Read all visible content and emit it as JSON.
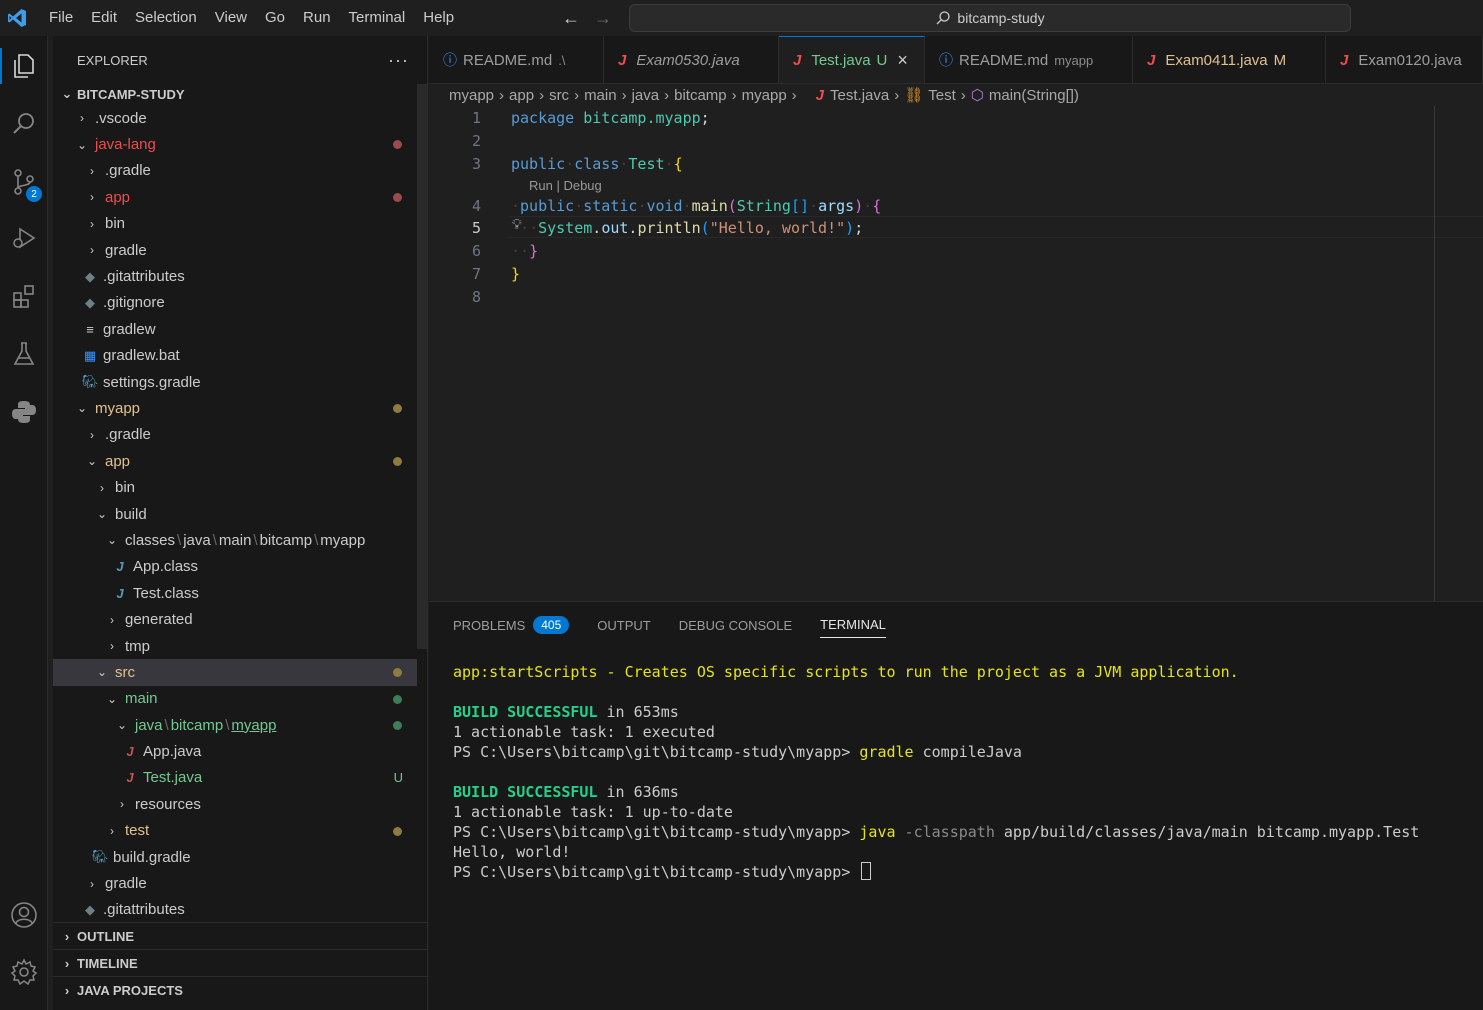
{
  "titlebar": {
    "menu": [
      "File",
      "Edit",
      "Selection",
      "View",
      "Go",
      "Run",
      "Terminal",
      "Help"
    ],
    "search_text": "bitcamp-study"
  },
  "activity": {
    "scm_badge": "2"
  },
  "sidebar": {
    "title": "EXPLORER",
    "more": "···",
    "root": "BITCAMP-STUDY",
    "items": [
      {
        "label": ".vscode"
      },
      {
        "label": "java-lang"
      },
      {
        "label": ".gradle"
      },
      {
        "label": "app"
      },
      {
        "label": "bin"
      },
      {
        "label": "gradle"
      },
      {
        "label": ".gitattributes"
      },
      {
        "label": ".gitignore"
      },
      {
        "label": "gradlew"
      },
      {
        "label": "gradlew.bat"
      },
      {
        "label": "settings.gradle"
      },
      {
        "label": "myapp"
      },
      {
        "label": ".gradle"
      },
      {
        "label": "app"
      },
      {
        "label": "bin"
      },
      {
        "label": "build"
      },
      {
        "label": "classes",
        "parts": [
          "java",
          "main",
          "bitcamp",
          "myapp"
        ]
      },
      {
        "label": "App.class"
      },
      {
        "label": "Test.class"
      },
      {
        "label": "generated"
      },
      {
        "label": "tmp"
      },
      {
        "label": "src"
      },
      {
        "label": "main"
      },
      {
        "label": "java",
        "parts": [
          "bitcamp",
          "myapp"
        ]
      },
      {
        "label": "App.java"
      },
      {
        "label": "Test.java",
        "status": "U"
      },
      {
        "label": "resources"
      },
      {
        "label": "test"
      },
      {
        "label": "build.gradle"
      },
      {
        "label": "gradle"
      },
      {
        "label": ".gitattributes"
      }
    ],
    "sections": [
      "OUTLINE",
      "TIMELINE",
      "JAVA PROJECTS"
    ]
  },
  "tabs": [
    {
      "label": "README.md",
      "desc": ".\\"
    },
    {
      "label": "Exam0530.java",
      "desc": ""
    },
    {
      "label": "Test.java",
      "desc": "",
      "status": "U",
      "close": "×"
    },
    {
      "label": "README.md",
      "desc": "myapp"
    },
    {
      "label": "Exam0411.java",
      "desc": "",
      "status": "M"
    },
    {
      "label": "Exam0120.java",
      "desc": ""
    }
  ],
  "breadcrumb": [
    "myapp",
    "app",
    "src",
    "main",
    "java",
    "bitcamp",
    "myapp",
    "Test.java",
    "Test",
    "main(String[])"
  ],
  "editor": {
    "line_numbers": [
      "1",
      "2",
      "3",
      "4",
      "5",
      "6",
      "7",
      "8"
    ],
    "codelens": "Run | Debug",
    "tokens": {
      "package_kw": "package",
      "package_name": "bitcamp.myapp",
      "semicolon": ";",
      "public": "public",
      "class": "class",
      "class_name": "Test",
      "open_brace": "{",
      "static": "static",
      "void": "void",
      "main": "main",
      "string_type": "String",
      "array": "[]",
      "args": "args",
      "paren_open": "(",
      "paren_close": ")",
      "system": "System",
      "out": "out",
      "println": "println",
      "dot": ".",
      "hello": "\"Hello, world!\"",
      "close_brace": "}"
    }
  },
  "panel": {
    "tabs": [
      "PROBLEMS",
      "OUTPUT",
      "DEBUG CONSOLE",
      "TERMINAL"
    ],
    "problems_count": "405",
    "terminal": {
      "l1_task": "app:startScripts",
      "l1_rest": " - Creates OS specific scripts to run the project as a JVM application.",
      "build_successful": "BUILD SUCCESSFUL",
      "l3_time": " in 653ms",
      "l4": "1 actionable task: 1 executed",
      "prompt": "PS C:\\Users\\bitcamp\\git\\bitcamp-study\\myapp> ",
      "cmd1_a": "gradle",
      "cmd1_b": " compileJava",
      "l7_time": " in 636ms",
      "l8": "1 actionable task: 1 up-to-date",
      "cmd2_a": "java",
      "cmd2_flag": " -classpath",
      "cmd2_rest": " app/build/classes/java/main bitcamp.myapp.Test",
      "output": "Hello, world!"
    }
  },
  "colors": {
    "accent": "#0078d4",
    "modified": "#e2c08d",
    "untracked": "#73c991",
    "error": "#f14c4c"
  }
}
